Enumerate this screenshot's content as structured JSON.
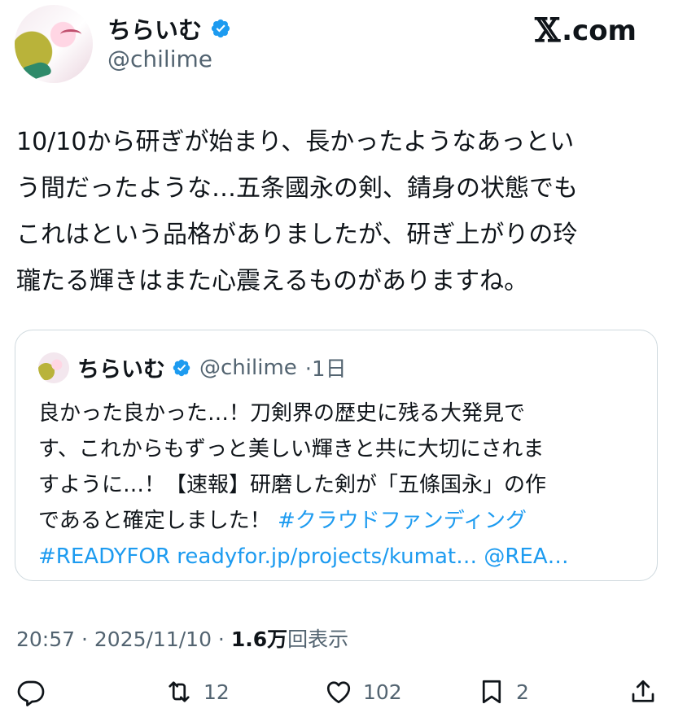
{
  "colors": {
    "accent": "#1d9bf0",
    "secondary": "#536471",
    "text": "#0f1419",
    "border": "#cfd9de"
  },
  "header": {
    "display_name": "ちらいむ",
    "handle": "@chilime",
    "site": "com",
    "verified_icon": "verified-badge-icon"
  },
  "tweet": {
    "text": "10/10から研ぎが始まり、長かったようなあっとい\nう間だったような…五条國永の剣、錆身の状態でも\nこれはという品格がありましたが、研ぎ上がりの玲\n瓏たる輝きはまた心震えるものがありますね。"
  },
  "quote": {
    "display_name": "ちらいむ",
    "handle": "@chilime",
    "time": "·1日",
    "lines": [
      "良かった良かった…！刀剣界の歴史に残る大発見で",
      "す、これからもずっと美しい輝きと共に大切にされま",
      "すように…！【速報】研磨した剣が「五條国永」の作"
    ],
    "line4_text": "であると確定しました！ ",
    "hashtag1": "#クラウドファンディング",
    "hashtag2": "#READYFOR",
    "url": "readyfor.jp/projects/kumat…",
    "mention": "@REA…"
  },
  "meta": {
    "time": "20:57 · 2025/11/10 · ",
    "views_count": "1.6万",
    "views_label": "回表示"
  },
  "actions": {
    "reply_icon": "reply-icon",
    "retweet_icon": "retweet-icon",
    "retweet_count": "12",
    "like_icon": "heart-icon",
    "like_count": "102",
    "bookmark_icon": "bookmark-icon",
    "bookmark_count": "2",
    "share_icon": "share-icon"
  }
}
